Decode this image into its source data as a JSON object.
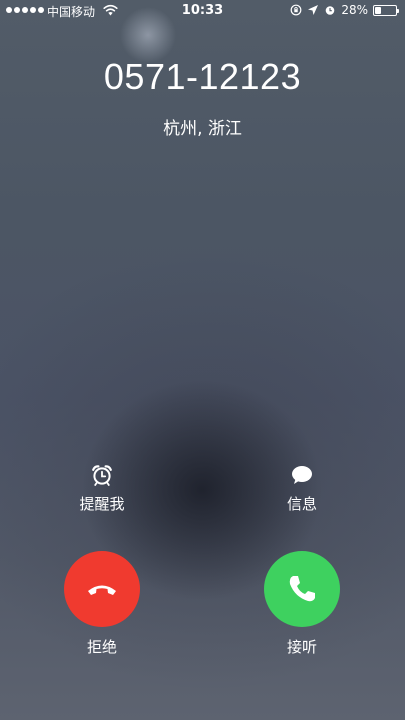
{
  "status_bar": {
    "carrier": "中国移动",
    "time": "10:33",
    "battery_percent": "28%",
    "battery_level": 0.28,
    "icons": [
      "signal-dots-icon",
      "wifi-icon",
      "orientation-lock-icon",
      "location-arrow-icon",
      "alarm-icon",
      "battery-icon"
    ]
  },
  "call": {
    "number": "0571-12123",
    "location": "杭州, 浙江"
  },
  "actions": {
    "remind_label": "提醒我",
    "message_label": "信息",
    "decline_label": "拒绝",
    "accept_label": "接听"
  },
  "colors": {
    "decline": "#f03a2f",
    "accept": "#3ed15f"
  }
}
